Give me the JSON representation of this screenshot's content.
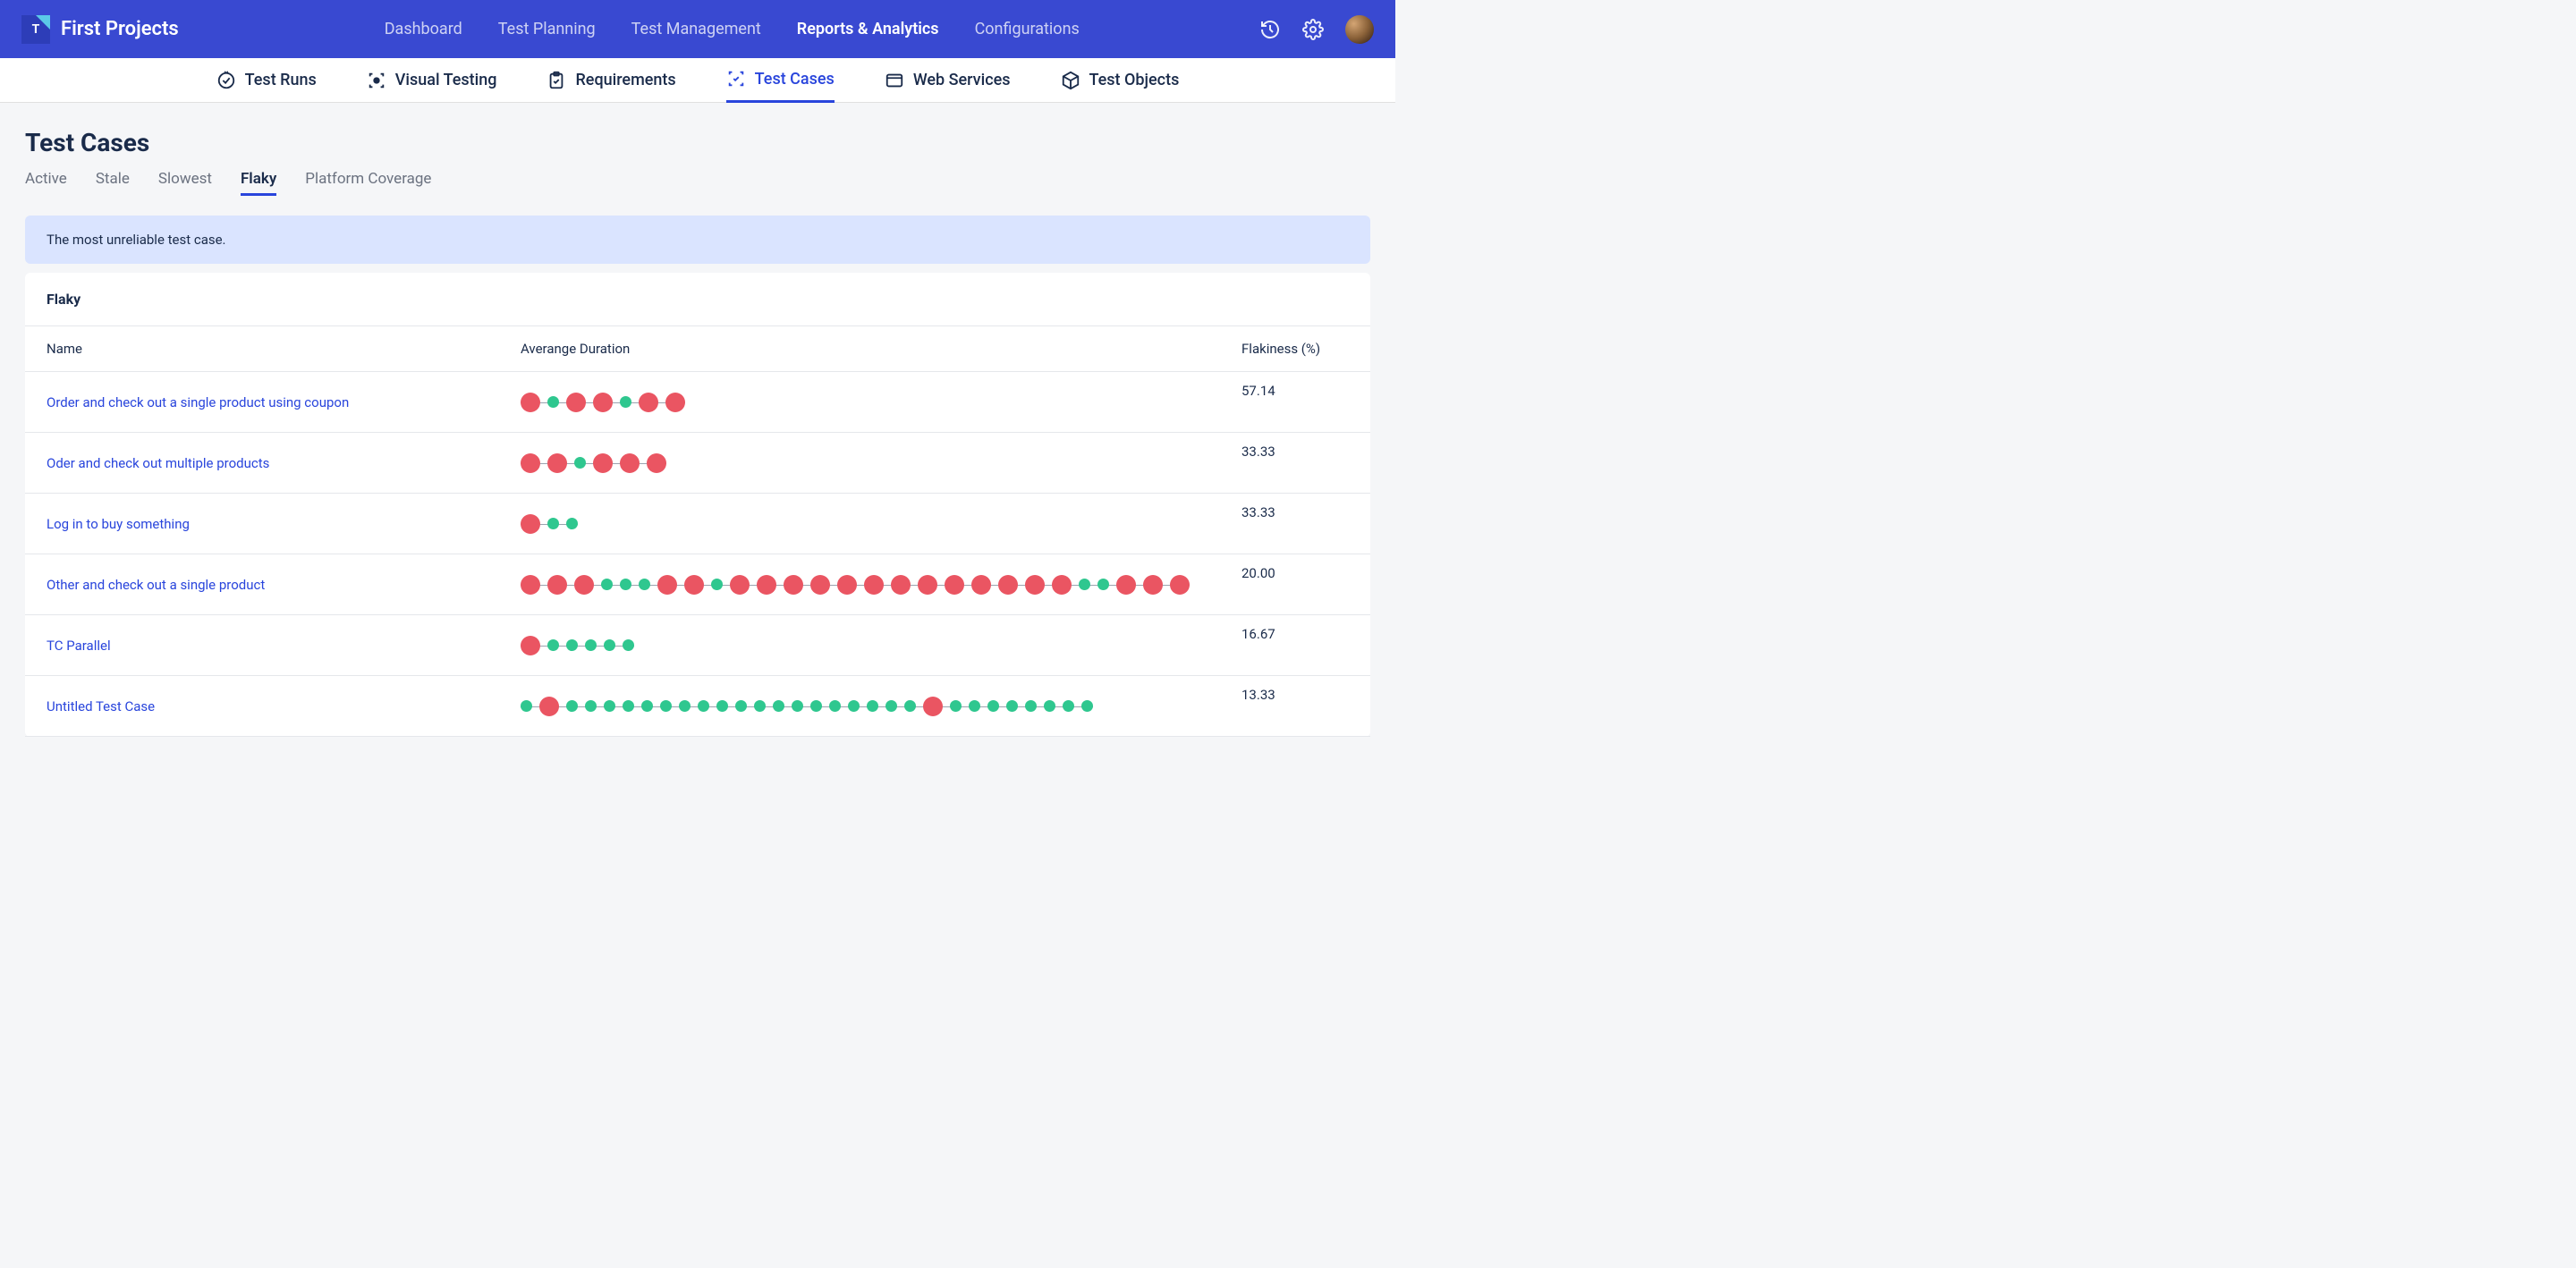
{
  "header": {
    "project_name": "First Projects",
    "nav": [
      {
        "label": "Dashboard",
        "active": false
      },
      {
        "label": "Test Planning",
        "active": false
      },
      {
        "label": "Test Management",
        "active": false
      },
      {
        "label": "Reports & Analytics",
        "active": true
      },
      {
        "label": "Configurations",
        "active": false
      }
    ]
  },
  "sub_nav": [
    {
      "label": "Test Runs",
      "icon": "check-circle-icon",
      "active": false
    },
    {
      "label": "Visual Testing",
      "icon": "focus-icon",
      "active": false
    },
    {
      "label": "Requirements",
      "icon": "clipboard-icon",
      "active": false
    },
    {
      "label": "Test Cases",
      "icon": "test-case-icon",
      "active": true
    },
    {
      "label": "Web Services",
      "icon": "browser-icon",
      "active": false
    },
    {
      "label": "Test Objects",
      "icon": "cube-icon",
      "active": false
    }
  ],
  "page": {
    "title": "Test Cases",
    "tabs": [
      {
        "label": "Active",
        "active": false
      },
      {
        "label": "Stale",
        "active": false
      },
      {
        "label": "Slowest",
        "active": false
      },
      {
        "label": "Flaky",
        "active": true
      },
      {
        "label": "Platform Coverage",
        "active": false
      }
    ],
    "banner": "The most unreliable test case.",
    "card_title": "Flaky",
    "columns": {
      "name": "Name",
      "duration": "Averange Duration",
      "flakiness": "Flakiness (%)"
    },
    "rows": [
      {
        "name": "Order and check out a single product using coupon",
        "flakiness": "57.14",
        "dots": [
          {
            "status": "fail",
            "size": "large"
          },
          {
            "status": "pass",
            "size": "small"
          },
          {
            "status": "fail",
            "size": "large"
          },
          {
            "status": "fail",
            "size": "large"
          },
          {
            "status": "pass",
            "size": "small"
          },
          {
            "status": "fail",
            "size": "large"
          },
          {
            "status": "fail",
            "size": "large"
          }
        ]
      },
      {
        "name": "Oder and check out multiple products",
        "flakiness": "33.33",
        "dots": [
          {
            "status": "fail",
            "size": "large"
          },
          {
            "status": "fail",
            "size": "large"
          },
          {
            "status": "pass",
            "size": "small"
          },
          {
            "status": "fail",
            "size": "large"
          },
          {
            "status": "fail",
            "size": "large"
          },
          {
            "status": "fail",
            "size": "large"
          }
        ]
      },
      {
        "name": "Log in to buy something",
        "flakiness": "33.33",
        "dots": [
          {
            "status": "fail",
            "size": "large"
          },
          {
            "status": "pass",
            "size": "small"
          },
          {
            "status": "pass",
            "size": "small"
          }
        ]
      },
      {
        "name": "Other and check out a single product",
        "flakiness": "20.00",
        "dots": [
          {
            "status": "fail",
            "size": "large"
          },
          {
            "status": "fail",
            "size": "large"
          },
          {
            "status": "fail",
            "size": "large"
          },
          {
            "status": "pass",
            "size": "small"
          },
          {
            "status": "pass",
            "size": "small"
          },
          {
            "status": "pass",
            "size": "small"
          },
          {
            "status": "fail",
            "size": "large"
          },
          {
            "status": "fail",
            "size": "large"
          },
          {
            "status": "pass",
            "size": "small"
          },
          {
            "status": "fail",
            "size": "large"
          },
          {
            "status": "fail",
            "size": "large"
          },
          {
            "status": "fail",
            "size": "large"
          },
          {
            "status": "fail",
            "size": "large"
          },
          {
            "status": "fail",
            "size": "large"
          },
          {
            "status": "fail",
            "size": "large"
          },
          {
            "status": "fail",
            "size": "large"
          },
          {
            "status": "fail",
            "size": "large"
          },
          {
            "status": "fail",
            "size": "large"
          },
          {
            "status": "fail",
            "size": "large"
          },
          {
            "status": "fail",
            "size": "large"
          },
          {
            "status": "fail",
            "size": "large"
          },
          {
            "status": "fail",
            "size": "large"
          },
          {
            "status": "pass",
            "size": "small"
          },
          {
            "status": "pass",
            "size": "small"
          },
          {
            "status": "fail",
            "size": "large"
          },
          {
            "status": "fail",
            "size": "large"
          },
          {
            "status": "fail",
            "size": "large"
          }
        ]
      },
      {
        "name": "TC Parallel",
        "flakiness": "16.67",
        "dots": [
          {
            "status": "fail",
            "size": "large"
          },
          {
            "status": "pass",
            "size": "small"
          },
          {
            "status": "pass",
            "size": "small"
          },
          {
            "status": "pass",
            "size": "small"
          },
          {
            "status": "pass",
            "size": "small"
          },
          {
            "status": "pass",
            "size": "small"
          }
        ]
      },
      {
        "name": "Untitled Test Case",
        "flakiness": "13.33",
        "dots": [
          {
            "status": "pass",
            "size": "small"
          },
          {
            "status": "fail",
            "size": "large"
          },
          {
            "status": "pass",
            "size": "small"
          },
          {
            "status": "pass",
            "size": "small"
          },
          {
            "status": "pass",
            "size": "small"
          },
          {
            "status": "pass",
            "size": "small"
          },
          {
            "status": "pass",
            "size": "small"
          },
          {
            "status": "pass",
            "size": "small"
          },
          {
            "status": "pass",
            "size": "small"
          },
          {
            "status": "pass",
            "size": "small"
          },
          {
            "status": "pass",
            "size": "small"
          },
          {
            "status": "pass",
            "size": "small"
          },
          {
            "status": "pass",
            "size": "small"
          },
          {
            "status": "pass",
            "size": "small"
          },
          {
            "status": "pass",
            "size": "small"
          },
          {
            "status": "pass",
            "size": "small"
          },
          {
            "status": "pass",
            "size": "small"
          },
          {
            "status": "pass",
            "size": "small"
          },
          {
            "status": "pass",
            "size": "small"
          },
          {
            "status": "pass",
            "size": "small"
          },
          {
            "status": "pass",
            "size": "small"
          },
          {
            "status": "fail",
            "size": "large"
          },
          {
            "status": "pass",
            "size": "small"
          },
          {
            "status": "pass",
            "size": "small"
          },
          {
            "status": "pass",
            "size": "small"
          },
          {
            "status": "pass",
            "size": "small"
          },
          {
            "status": "pass",
            "size": "small"
          },
          {
            "status": "pass",
            "size": "small"
          },
          {
            "status": "pass",
            "size": "small"
          },
          {
            "status": "pass",
            "size": "small"
          }
        ]
      }
    ]
  }
}
